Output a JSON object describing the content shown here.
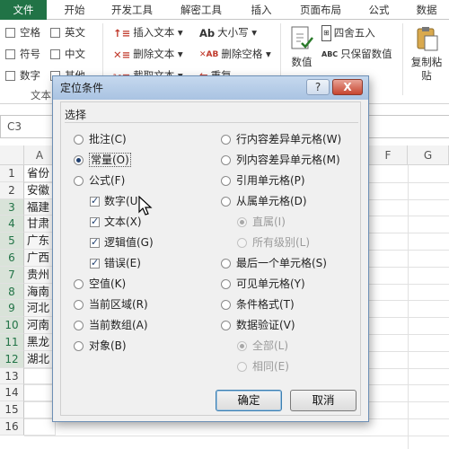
{
  "ribbon_tabs": [
    "文件",
    "开始",
    "开发工具",
    "解密工具",
    "插入",
    "页面布局",
    "公式",
    "数据"
  ],
  "ribbon": {
    "left_checks": [
      "空格",
      "英文",
      "符号",
      "中文",
      "数字",
      "其他"
    ],
    "group_label": "文本",
    "text_tools": [
      "插入文本",
      "删除文本",
      "截取文本"
    ],
    "case_tools": [
      "大小写",
      "删除空格",
      "重复"
    ],
    "number_button": "数值",
    "number_tools": [
      "四舍五入",
      "只保留数值"
    ],
    "paste_button_line1": "复制粘",
    "paste_button_line2": "贴"
  },
  "namebox": "C3",
  "columns": [
    "A",
    "F",
    "G"
  ],
  "rows": [
    {
      "num": "1",
      "value": "省份",
      "selected": false
    },
    {
      "num": "2",
      "value": "安徽",
      "selected": false
    },
    {
      "num": "3",
      "value": "福建",
      "selected": true
    },
    {
      "num": "4",
      "value": "甘肃",
      "selected": true
    },
    {
      "num": "5",
      "value": "广东",
      "selected": true
    },
    {
      "num": "6",
      "value": "广西",
      "selected": true
    },
    {
      "num": "7",
      "value": "贵州",
      "selected": true
    },
    {
      "num": "8",
      "value": "海南",
      "selected": true
    },
    {
      "num": "9",
      "value": "河北",
      "selected": true
    },
    {
      "num": "10",
      "value": "河南",
      "selected": true
    },
    {
      "num": "11",
      "value": "黑龙",
      "selected": true
    },
    {
      "num": "12",
      "value": "湖北",
      "selected": true
    },
    {
      "num": "13",
      "value": "",
      "selected": false
    },
    {
      "num": "14",
      "value": "",
      "selected": false
    },
    {
      "num": "15",
      "value": "",
      "selected": false
    },
    {
      "num": "16",
      "value": "",
      "selected": false
    }
  ],
  "dialog": {
    "title": "定位条件",
    "help_label": "?",
    "close_label": "X",
    "section_label": "选择",
    "left_options": {
      "comments": "批注(C)",
      "constants": "常量(O)",
      "formulas": "公式(F)",
      "numbers": "数字(U)",
      "text": "文本(X)",
      "logicals": "逻辑值(G)",
      "errors": "错误(E)",
      "blanks": "空值(K)",
      "current_region": "当前区域(R)",
      "current_array": "当前数组(A)",
      "objects": "对象(B)"
    },
    "right_options": {
      "row_differences": "行内容差异单元格(W)",
      "column_differences": "列内容差异单元格(M)",
      "precedents": "引用单元格(P)",
      "dependents": "从属单元格(D)",
      "direct_only": "直属(I)",
      "all_levels": "所有级别(L)",
      "last_cell": "最后一个单元格(S)",
      "visible_cells": "可见单元格(Y)",
      "conditional_formats": "条件格式(T)",
      "data_validation": "数据验证(V)",
      "all": "全部(L)",
      "same": "相同(E)"
    },
    "ok_label": "确定",
    "cancel_label": "取消"
  },
  "colors": {
    "excel_green": "#217346",
    "dialog_title_bg": "#b8cee9",
    "dialog_bg": "#f0f0f0",
    "close_red": "#c7452f"
  }
}
